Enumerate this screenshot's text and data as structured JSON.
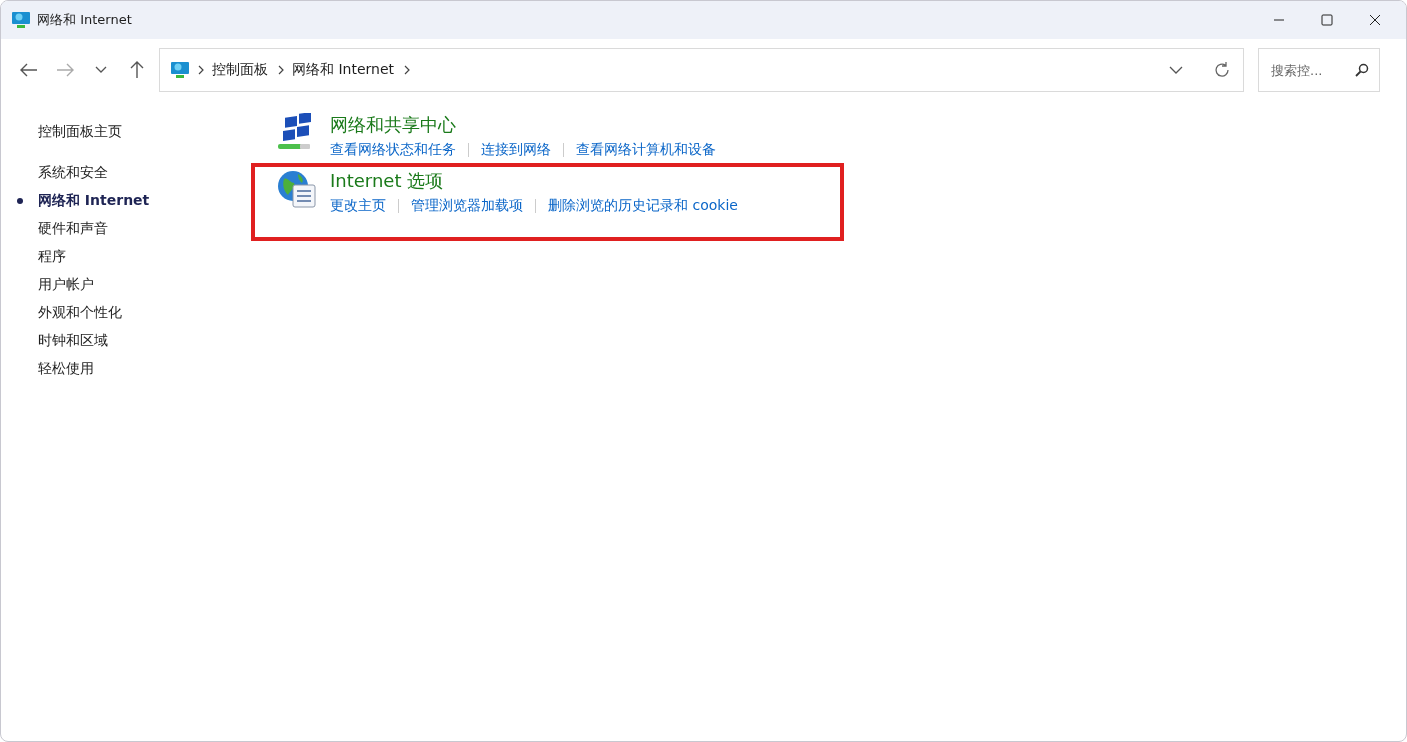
{
  "window": {
    "title": "网络和 Internet"
  },
  "address_bar": {
    "breadcrumbs": [
      "控制面板",
      "网络和 Internet"
    ]
  },
  "search": {
    "placeholder": "搜索控..."
  },
  "sidebar": {
    "home": "控制面板主页",
    "items": [
      {
        "label": "系统和安全",
        "selected": false
      },
      {
        "label": "网络和 Internet",
        "selected": true
      },
      {
        "label": "硬件和声音",
        "selected": false
      },
      {
        "label": "程序",
        "selected": false
      },
      {
        "label": "用户帐户",
        "selected": false
      },
      {
        "label": "外观和个性化",
        "selected": false
      },
      {
        "label": "时钟和区域",
        "selected": false
      },
      {
        "label": "轻松使用",
        "selected": false
      }
    ]
  },
  "sections": [
    {
      "kind": "network",
      "title": "网络和共享中心",
      "highlighted": false,
      "links": [
        "查看网络状态和任务",
        "连接到网络",
        "查看网络计算机和设备"
      ]
    },
    {
      "kind": "internet",
      "title": "Internet 选项",
      "highlighted": true,
      "links": [
        "更改主页",
        "管理浏览器加载项",
        "删除浏览的历史记录和 cookie"
      ]
    }
  ]
}
